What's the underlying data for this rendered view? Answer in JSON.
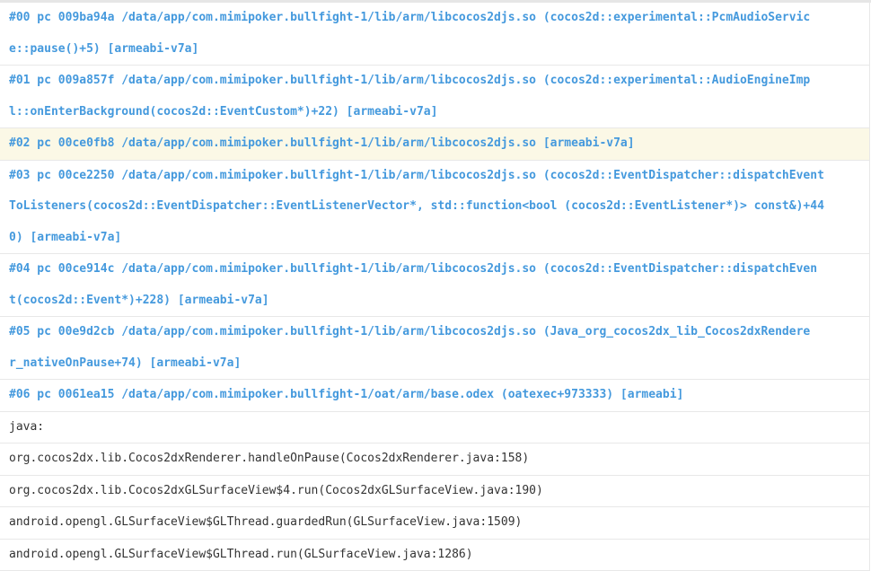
{
  "colors": {
    "stack_frame_text": "#4499dd",
    "plain_text": "#333333",
    "highlight_row": "#fbf8e6",
    "divider": "#e8e8e8"
  },
  "log": {
    "rows": [
      {
        "kind": "stack",
        "highlight": false,
        "text": "#00 pc 009ba94a /data/app/com.mimipoker.bullfight-1/lib/arm/libcocos2djs.so (cocos2d::experimental::PcmAudioServic\ne::pause()+5) [armeabi-v7a]"
      },
      {
        "kind": "stack",
        "highlight": false,
        "text": "#01 pc 009a857f /data/app/com.mimipoker.bullfight-1/lib/arm/libcocos2djs.so (cocos2d::experimental::AudioEngineImp\nl::onEnterBackground(cocos2d::EventCustom*)+22) [armeabi-v7a]"
      },
      {
        "kind": "stack",
        "highlight": true,
        "text": "#02 pc 00ce0fb8 /data/app/com.mimipoker.bullfight-1/lib/arm/libcocos2djs.so [armeabi-v7a]"
      },
      {
        "kind": "stack",
        "highlight": false,
        "text": "#03 pc 00ce2250 /data/app/com.mimipoker.bullfight-1/lib/arm/libcocos2djs.so (cocos2d::EventDispatcher::dispatchEvent\nToListeners(cocos2d::EventDispatcher::EventListenerVector*, std::function<bool (cocos2d::EventListener*)> const&)+44\n0) [armeabi-v7a]"
      },
      {
        "kind": "stack",
        "highlight": false,
        "text": "#04 pc 00ce914c /data/app/com.mimipoker.bullfight-1/lib/arm/libcocos2djs.so (cocos2d::EventDispatcher::dispatchEven\nt(cocos2d::Event*)+228) [armeabi-v7a]"
      },
      {
        "kind": "stack",
        "highlight": false,
        "text": "#05 pc 00e9d2cb /data/app/com.mimipoker.bullfight-1/lib/arm/libcocos2djs.so (Java_org_cocos2dx_lib_Cocos2dxRendere\nr_nativeOnPause+74) [armeabi-v7a]"
      },
      {
        "kind": "stack",
        "highlight": false,
        "text": "#06 pc 0061ea15 /data/app/com.mimipoker.bullfight-1/oat/arm/base.odex (oatexec+973333) [armeabi]"
      },
      {
        "kind": "plain",
        "highlight": false,
        "text": "java:"
      },
      {
        "kind": "plain",
        "highlight": false,
        "text": "org.cocos2dx.lib.Cocos2dxRenderer.handleOnPause(Cocos2dxRenderer.java:158)"
      },
      {
        "kind": "plain",
        "highlight": false,
        "text": "org.cocos2dx.lib.Cocos2dxGLSurfaceView$4.run(Cocos2dxGLSurfaceView.java:190)"
      },
      {
        "kind": "plain",
        "highlight": false,
        "text": "android.opengl.GLSurfaceView$GLThread.guardedRun(GLSurfaceView.java:1509)"
      },
      {
        "kind": "plain",
        "highlight": false,
        "text": "android.opengl.GLSurfaceView$GLThread.run(GLSurfaceView.java:1286)"
      }
    ]
  }
}
